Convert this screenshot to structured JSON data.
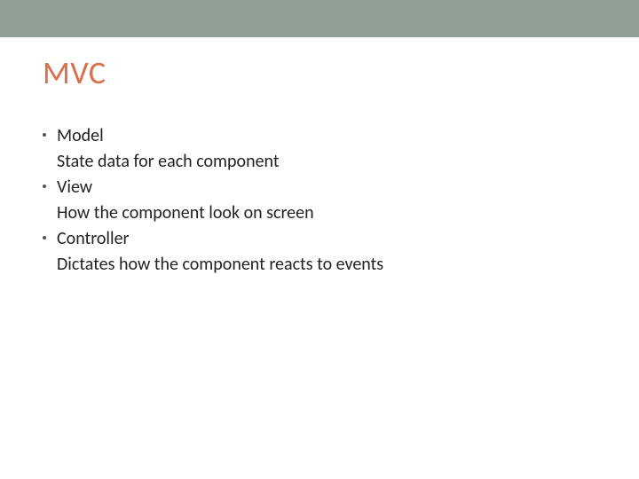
{
  "title": "MVC",
  "colors": {
    "topbar": "#8f9f96",
    "accent": "#d96f4b"
  },
  "items": [
    {
      "label": "Model",
      "desc": "State data for each component"
    },
    {
      "label": "View",
      "desc": "How the component look on screen"
    },
    {
      "label": "Controller",
      "desc": "Dictates how the component reacts to events"
    }
  ]
}
